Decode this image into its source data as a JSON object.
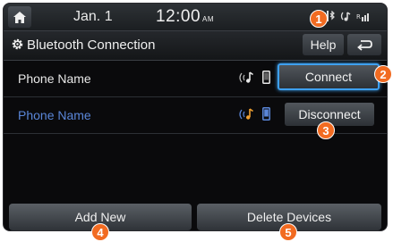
{
  "statusbar": {
    "date": "Jan.  1",
    "time": "12:00",
    "ampm": "AM"
  },
  "titlebar": {
    "title": "Bluetooth Connection",
    "help_label": "Help"
  },
  "devices": [
    {
      "name": "Phone Name",
      "action_label": "Connect",
      "selected": true
    },
    {
      "name": "Phone Name",
      "action_label": "Disconnect",
      "selected": false
    }
  ],
  "bottom": {
    "add_new_label": "Add New",
    "delete_label": "Delete Devices"
  },
  "markers": [
    "1",
    "2",
    "3",
    "4",
    "5"
  ],
  "colors": {
    "accent": "#3ea0f0",
    "connected_name": "#5a86d8",
    "marker": "#f26b21"
  }
}
